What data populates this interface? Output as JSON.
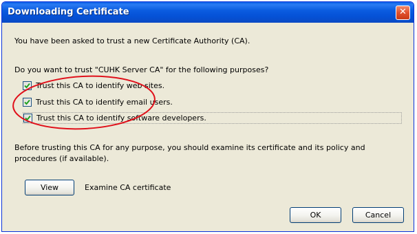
{
  "window": {
    "title": "Downloading Certificate",
    "close_glyph": "✕"
  },
  "intro_text": "You have been asked to trust a new Certificate Authority (CA).",
  "question_text": "Do you want to trust \"CUHK Server CA\" for the following purposes?",
  "purposes": [
    {
      "label": "Trust this CA to identify web sites.",
      "checked": true
    },
    {
      "label": "Trust this CA to identify email users.",
      "checked": true
    },
    {
      "label": "Trust this CA to identify software developers.",
      "checked": true
    }
  ],
  "note_text": "Before trusting this CA for any purpose, you should examine its certificate and its policy and procedures (if available).",
  "view_button_label": "View",
  "view_caption": "Examine CA certificate",
  "ok_label": "OK",
  "cancel_label": "Cancel",
  "colors": {
    "titlebar": "#0A5FE8",
    "window_bg": "#ECE9D8",
    "close_button": "#E1512E",
    "check_mark": "#21A121",
    "annotation_circle": "#E0101A"
  }
}
